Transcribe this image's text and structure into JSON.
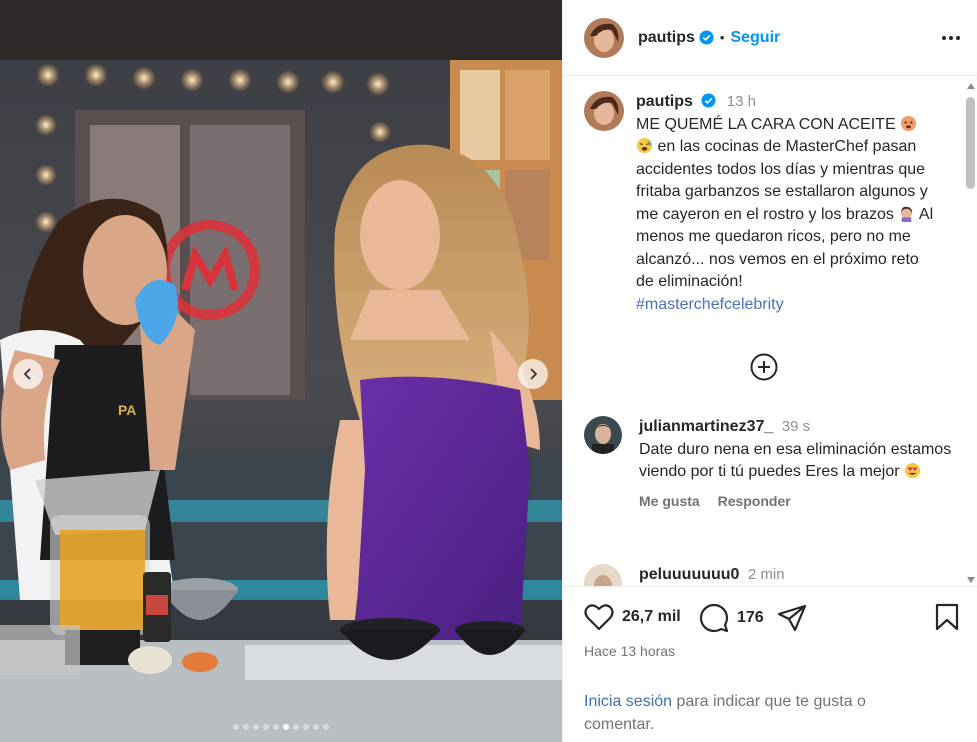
{
  "post": {
    "username": "pautips",
    "follow_label": "Seguir",
    "separator": "•",
    "caption": {
      "time": "13 h",
      "line1": "ME QUEMÉ LA CARA CON ACEITE",
      "text": "en las cocinas de MasterChef pasan accidentes todos los días y mientras que fritaba garbanzos se estallaron algunos y me cayeron en el rostro y los brazos",
      "text2": "Al menos me quedaron ricos, pero no me alcanzó... nos vemos en el próximo reto de eliminación!",
      "hashtag": "#masterchefcelebrity"
    },
    "comments": [
      {
        "username": "julianmartinez37_",
        "time": "39 s",
        "text": "Date duro nena en esa eliminación estamos viendo por ti tú puedes Eres la mejor",
        "like_label": "Me gusta",
        "reply_label": "Responder"
      },
      {
        "username": "peluuuuuuu0",
        "time": "2 min"
      }
    ],
    "likes": "26,7 mil",
    "comments_count": "176",
    "posted_ago": "Hace 13 horas",
    "login_link": "Inicia sesión",
    "login_text": " para indicar que te gusta o comentar."
  },
  "carousel": {
    "slides": 10,
    "active_index": 5
  },
  "colors": {
    "accent": "#0095f6",
    "hashtag": "#4c70c4",
    "muted": "#737373",
    "dress": "#5b2a8e"
  },
  "icons": [
    "verified-icon",
    "more-options-icon",
    "add-circle-icon",
    "heart-icon",
    "comment-icon",
    "share-icon",
    "bookmark-icon",
    "chevron-left-icon",
    "chevron-right-icon"
  ]
}
